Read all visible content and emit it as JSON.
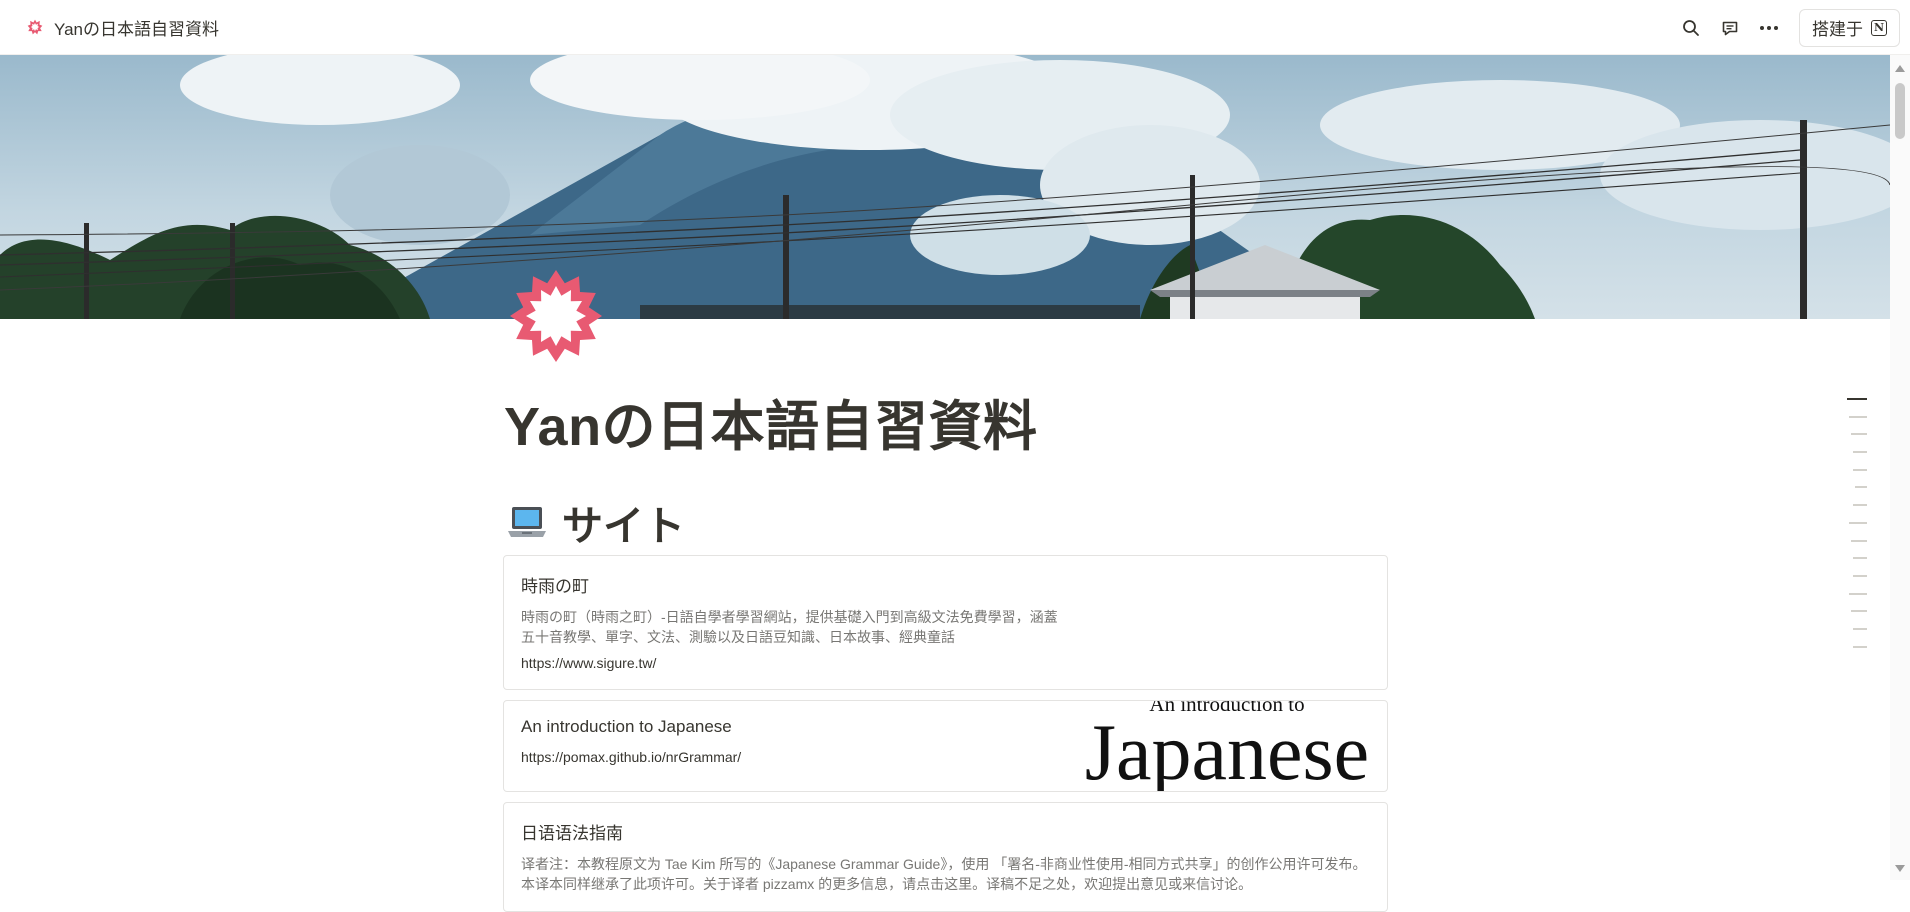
{
  "topbar": {
    "title": "Yanの日本語自習資料",
    "build_label": "搭建于",
    "notion_letter": "N",
    "icons": [
      "search-icon",
      "comment-icon",
      "more-icon"
    ]
  },
  "page": {
    "title": "Yanの日本語自習資料",
    "icon": "sakura-icon",
    "cover": "mount-fuji-cloud-photo"
  },
  "section": {
    "emoji": "laptop-icon",
    "heading": "サイト"
  },
  "bookmarks": [
    {
      "title": "時雨の町",
      "description": "時雨の町（時雨之町）-日語自學者學習網站，提供基礎入門到高級文法免費學習，涵蓋五十音教學、單字、文法、測驗以及日語豆知識、日本故事、經典童話",
      "url": "https://www.sigure.tw/"
    },
    {
      "title": "An introduction to Japanese",
      "url": "https://pomax.github.io/nrGrammar/",
      "thumb_small": "An introduction to",
      "thumb_big": "Japanese"
    },
    {
      "title": "日语语法指南",
      "description": "译者注：本教程原文为 Tae Kim 所写的《Japanese Grammar Guide》，使用 「署名-非商业性使用-相同方式共享」的创作公用许可发布。本译本同样继承了此项许可。关于译者 pizzamx 的更多信息，请点击这里。译稿不足之处，欢迎提出意见或来信讨论。"
    }
  ],
  "toc": {
    "count": 15,
    "active_index": 0
  },
  "colors": {
    "text": "#37352f",
    "muted": "#787774",
    "border": "#e4e3e1",
    "sakura": "#e85a72"
  }
}
